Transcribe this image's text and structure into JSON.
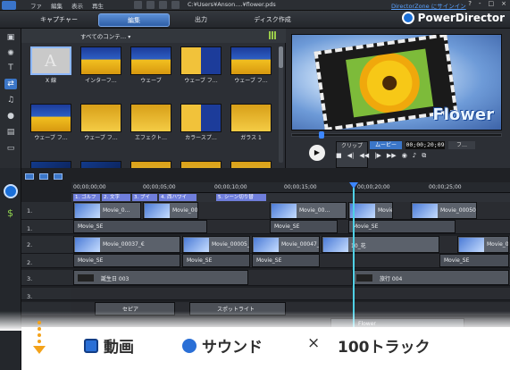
{
  "titlebar": {
    "menu": [
      "ファ",
      "編集",
      "表示",
      "再生"
    ],
    "path": "C:¥Users¥Anson....¥flower.pds",
    "login": "DirectorZone にサインイン",
    "help": [
      "?",
      "-",
      "□",
      "×"
    ]
  },
  "tabs": {
    "capture": "キャプチャー",
    "edit": "編集",
    "output": "出力",
    "disc": "ディスク作成"
  },
  "brand": "PowerDirector",
  "library": {
    "filter": "すべてのコンテ…",
    "items": [
      {
        "label": "X 線",
        "style": "selected"
      },
      {
        "label": "インターフ…",
        "style": "blue"
      },
      {
        "label": "ウェーブ",
        "style": "blue"
      },
      {
        "label": "ウェーブ フ…",
        "style": "bluegold"
      },
      {
        "label": "ウェーブ フ…",
        "style": "blue"
      },
      {
        "label": "ウェーブ フ…",
        "style": "blue"
      },
      {
        "label": "ウェーブ フ…",
        "style": "gold"
      },
      {
        "label": "エフェクト…",
        "style": "gold"
      },
      {
        "label": "カラースプ…",
        "style": "bluegold"
      },
      {
        "label": "ガラス 1",
        "style": "gold"
      }
    ]
  },
  "preview": {
    "overlay_text": "Flower",
    "clip_label": "クリップ",
    "movie_label": "ムービー",
    "timecode": "00;00;20;09",
    "fit": "フ…"
  },
  "timeline": {
    "ruler": [
      "00;00;00;00",
      "00;00;05;00",
      "00;00;10;00",
      "00;00;15;00",
      "00;00;20;00",
      "00;00;25;00"
    ],
    "chapters": [
      "1. ゴルフ",
      "2. 文字",
      "3. ブイ",
      "4. 西ハワイ",
      "5. シーン切り替"
    ],
    "tracks": [
      {
        "name": "1.",
        "clips": [
          {
            "label": "Movie_0…"
          },
          {
            "label": "Movie_00002_…"
          },
          {
            "label": "Movie_00…"
          },
          {
            "label": "Movie_0"
          },
          {
            "label": "Movie_00050_"
          }
        ]
      },
      {
        "name": "1.",
        "clips": [
          {
            "label": "Movie_SE"
          },
          {
            "label": "Movie_SE"
          },
          {
            "label": "Movie_SE"
          }
        ]
      },
      {
        "name": "2.",
        "clips": [
          {
            "label": "Movie_00037_€"
          },
          {
            "label": "Movie_00005_€"
          },
          {
            "label": "Movie_00047_€"
          },
          {
            "label": "10_花"
          },
          {
            "label": "Movie_00"
          }
        ]
      },
      {
        "name": "2.",
        "clips": [
          {
            "label": "Movie_SE"
          },
          {
            "label": "Movie_SE"
          },
          {
            "label": "Movie_SE"
          },
          {
            "label": "Movie_SE"
          }
        ]
      },
      {
        "name": "3.",
        "clips": [
          {
            "label": "誕生日 003"
          },
          {
            "label": "旅行 004"
          }
        ]
      },
      {
        "name": "3.",
        "clips": []
      },
      {
        "name": "",
        "clips": [
          {
            "label": "セピア"
          },
          {
            "label": "スポットライト"
          }
        ]
      },
      {
        "name": "",
        "clips": [
          {
            "label": "Flower"
          }
        ]
      }
    ]
  },
  "banner": {
    "feature1": "動画",
    "feature2": "サウンド",
    "times": "×",
    "feature3": "100トラック"
  },
  "colors": {
    "accent": "#3b76c8",
    "link": "#5aa2ff",
    "playhead": "#4fd1e6"
  }
}
